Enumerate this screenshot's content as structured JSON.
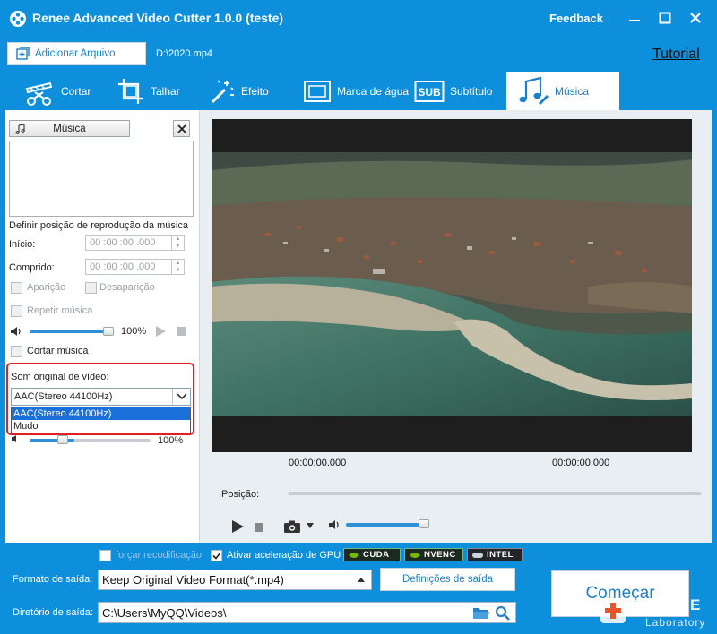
{
  "app": {
    "title": "Renee Advanced Video Cutter 1.0.0 (teste)",
    "feedback": "Feedback"
  },
  "toolbar": {
    "add_file": "Adicionar Arquivo",
    "file_path": "D:\\2020.mp4",
    "tutorial": "Tutorial"
  },
  "tabs": [
    {
      "label": "Cortar",
      "icon": "clapper-scissors-icon"
    },
    {
      "label": "Talhar",
      "icon": "crop-film-icon"
    },
    {
      "label": "Efeito",
      "icon": "magic-wand-icon"
    },
    {
      "label": "Marca de água",
      "icon": "watermark-icon"
    },
    {
      "label": "Subtítulo",
      "icon": "subtitle-icon"
    },
    {
      "label": "Música",
      "icon": "music-note-icon",
      "active": true
    }
  ],
  "music_panel": {
    "music_button": "Música",
    "position_heading": "Definir posição de reprodução da música",
    "start_label": "Início:",
    "start_value": "00 :00 :00 .000",
    "length_label": "Comprido:",
    "length_value": "00 :00 :00 .000",
    "fade_in": "Aparição",
    "fade_out": "Desaparição",
    "repeat": "Repetir música",
    "music_volume": "100%",
    "music_volume_level": 1.0,
    "cut_music": "Cortar música",
    "original_sound_label": "Som original de vídeo:",
    "original_sound_selected": "AAC(Stereo 44100Hz)",
    "original_sound_options": [
      "AAC(Stereo 44100Hz)",
      "Mudo"
    ],
    "original_volume": "100%",
    "original_volume_level": 0.37
  },
  "player": {
    "time_left": "00:00:00.000",
    "time_right": "00:00:00.000",
    "position_label": "Posição:",
    "volume_level": 1.0
  },
  "bottom": {
    "force_reencode": "forçar recodificação",
    "gpu_accel": "Ativar aceleração de GPU",
    "gpu_badges": [
      "CUDA",
      "NVENC",
      "INTEL"
    ],
    "output_format_label": "Formato de saída:",
    "output_format_value": "Keep Original Video Format(*.mp4)",
    "output_settings": "Definições de saída",
    "output_dir_label": "Diretório de saída:",
    "output_dir_value": "C:\\Users\\MyQQ\\Videos\\",
    "start": "Começar"
  },
  "watermark": {
    "brand": "RENE.E",
    "sub": "Laboratory"
  },
  "colors": {
    "brand_blue": "#0e8fdc",
    "highlight_red": "#e02020",
    "selection_blue": "#1a6fd8"
  }
}
